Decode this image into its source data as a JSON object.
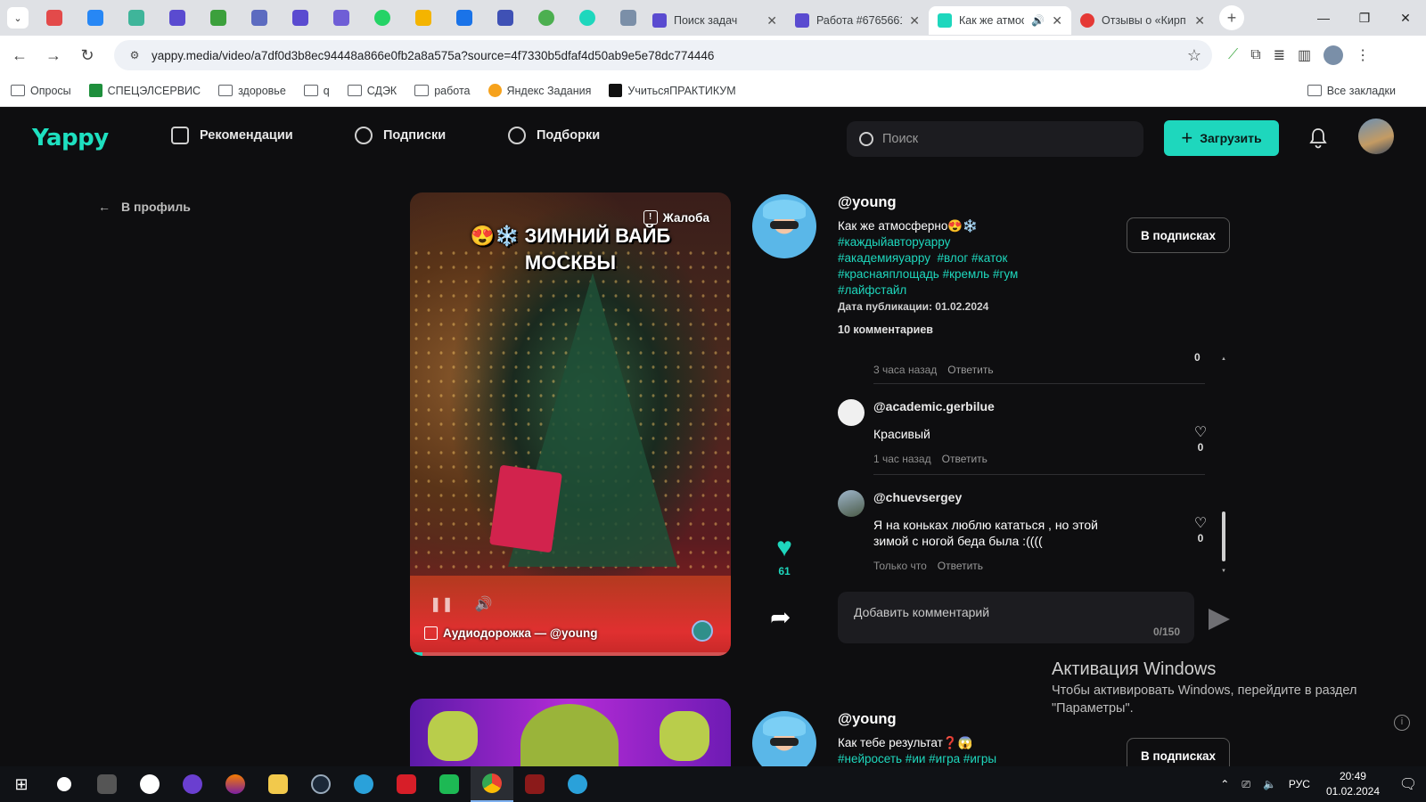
{
  "browser": {
    "tabs": [
      {
        "title": "Поиск задач",
        "active": false
      },
      {
        "title": "Работа #6765661",
        "active": false
      },
      {
        "title": "Как же атмосферно",
        "active": true
      },
      {
        "title": "Отзывы о «Кирп",
        "active": false
      }
    ],
    "url": "yappy.media/video/a7df0d3b8ec94448a866e0fb2a8a575a?source=4f7330b5dfaf4d50ab9e5e78dc774446",
    "bookmarks": [
      "Опросы",
      "СПЕЦЭЛСЕРВИС",
      "здоровье",
      "q",
      "СДЭК",
      "работа",
      "Яндекс Задания",
      "УчитьсяПРАКТИКУМ"
    ],
    "all_bookmarks": "Все закладки"
  },
  "header": {
    "logo": "Yappy",
    "nav": [
      "Рекомендации",
      "Подписки",
      "Подборки"
    ],
    "search_placeholder": "Поиск",
    "upload_label": "Загрузить"
  },
  "back_label": "В профиль",
  "video": {
    "overlay_title_line1": "😍❄️ ЗИМНИЙ ВАЙБ",
    "overlay_title_line2": "МОСКВЫ",
    "complaint_label": "Жалоба",
    "audio_label": "Аудиодорожка — @young",
    "progress": 0.04
  },
  "likes": "61",
  "post": {
    "username": "@young",
    "description": "Как же атмосферно😍❄️",
    "hashtags": [
      "#каждыйавторуарру",
      "#академияуарру",
      "#влог",
      "#каток",
      "#краснаяплощадь",
      "#кремль",
      "#гум",
      "#лайфстайл"
    ],
    "hashtag_lines": [
      "#каждыйавторуарру",
      "#академияуарру  #влог #каток",
      "#краснаяплощадь #кремль #гум",
      "#лайфстайл"
    ],
    "publish_date": "Дата публикации: 01.02.2024",
    "comments_count": "10 комментариев",
    "subscribe_label": "В подписках"
  },
  "comments": {
    "partial": {
      "time": "3 часа назад",
      "reply": "Ответить",
      "likes": "0"
    },
    "items": [
      {
        "author": "@academic.gerbilue",
        "text": "Красивый",
        "time": "1 час назад",
        "reply": "Ответить",
        "likes": "0"
      },
      {
        "author": "@chuevsergey",
        "text": "Я на коньках люблю кататься , но этой зимой с ногой беда была :((((",
        "time": "Только что",
        "reply": "Ответить",
        "likes": "0"
      }
    ],
    "input_placeholder": "Добавить комментарий",
    "limit": "0/150"
  },
  "next_post": {
    "username": "@young",
    "description": "Как тебе результат❓😱",
    "hashtags": "#нейросеть #ии #игра #игры",
    "subscribe_label": "В подписках"
  },
  "windows_activation": {
    "title": "Активация Windows",
    "text": "Чтобы активировать Windows, перейдите в раздел \"Параметры\"."
  },
  "taskbar": {
    "lang": "РУС",
    "time": "20:49",
    "date": "01.02.2024"
  },
  "colors": {
    "accent": "#1ed7bd",
    "background": "#0e0e10"
  }
}
